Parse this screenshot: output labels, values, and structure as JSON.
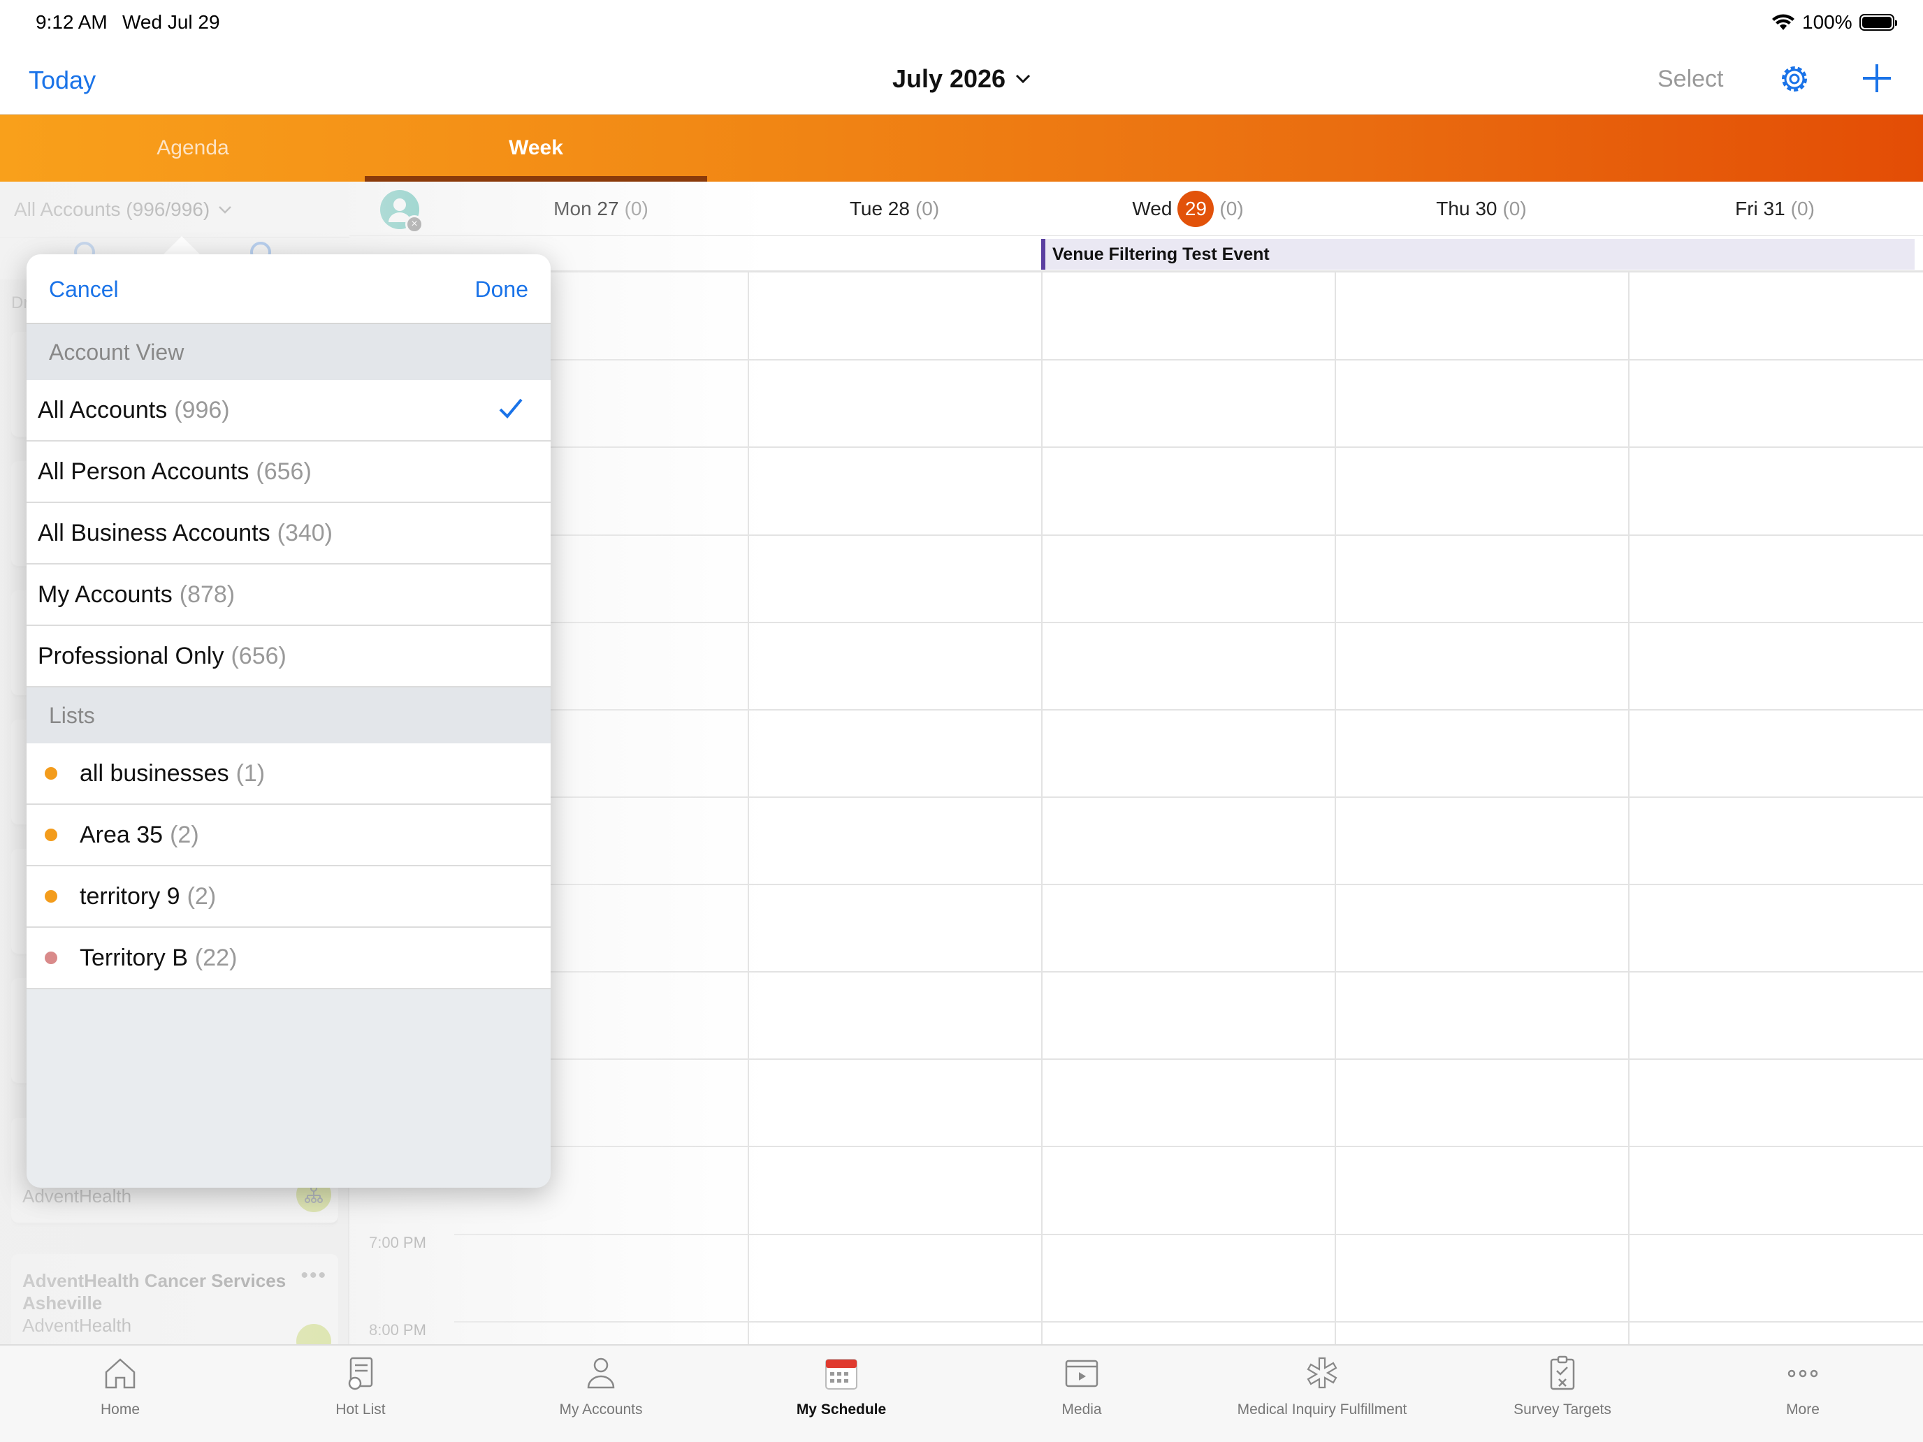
{
  "status": {
    "time": "9:12 AM",
    "date": "Wed Jul 29",
    "battery": "100%"
  },
  "nav": {
    "today": "Today",
    "month": "July 2026",
    "select": "Select"
  },
  "tabs": {
    "agenda": "Agenda",
    "week": "Week"
  },
  "left": {
    "filter": "All Accounts (996/996)",
    "label": "Dr",
    "cards": [
      {
        "title": "AdventHealth Cancer Services Asheville",
        "sub": "AdventHealth"
      }
    ],
    "partial_sub": "AdventHealth",
    "more": "•••"
  },
  "calendar": {
    "days": [
      {
        "label": "Mon 27",
        "count": "(0)"
      },
      {
        "label": "Tue 28",
        "count": "(0)"
      },
      {
        "label": "Wed",
        "num": "29",
        "count": "(0)"
      },
      {
        "label": "Thu 30",
        "count": "(0)"
      },
      {
        "label": "Fri 31",
        "count": "(0)"
      }
    ],
    "event": "Venue Filtering Test Event",
    "times": [
      "7:00 PM",
      "8:00 PM"
    ]
  },
  "popover": {
    "cancel": "Cancel",
    "done": "Done",
    "account_view_header": "Account View",
    "account_views": [
      {
        "label": "All Accounts",
        "count": "(996)",
        "selected": true
      },
      {
        "label": "All Person Accounts",
        "count": "(656)"
      },
      {
        "label": "All Business Accounts",
        "count": "(340)"
      },
      {
        "label": "My Accounts",
        "count": "(878)"
      },
      {
        "label": "Professional Only",
        "count": "(656)"
      }
    ],
    "lists_header": "Lists",
    "lists": [
      {
        "label": "all businesses",
        "count": "(1)",
        "color": "#f39c1c"
      },
      {
        "label": "Area 35",
        "count": "(2)",
        "color": "#f39c1c"
      },
      {
        "label": "territory 9",
        "count": "(2)",
        "color": "#f39c1c"
      },
      {
        "label": "Territory B",
        "count": "(22)",
        "color": "#d98a8a"
      }
    ]
  },
  "bottom_tabs": [
    {
      "label": "Home",
      "icon": "home-icon"
    },
    {
      "label": "Hot List",
      "icon": "hot-list-icon"
    },
    {
      "label": "My Accounts",
      "icon": "person-icon"
    },
    {
      "label": "My Schedule",
      "icon": "calendar-icon",
      "active": true
    },
    {
      "label": "Media",
      "icon": "media-icon"
    },
    {
      "label": "Medical Inquiry Fulfillment",
      "icon": "medical-icon"
    },
    {
      "label": "Survey Targets",
      "icon": "clipboard-icon"
    },
    {
      "label": "More",
      "icon": "more-icon"
    }
  ],
  "colors": {
    "accent": "#1a73e8",
    "orange_start": "#f9a01b",
    "orange_end": "#e34d05",
    "today": "#e2520a",
    "event_bar": "#5a3fa0"
  }
}
